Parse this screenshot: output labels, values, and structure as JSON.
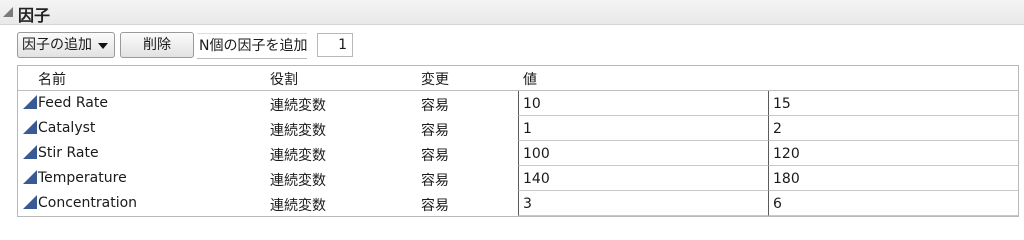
{
  "section": {
    "title": "因子"
  },
  "toolbar": {
    "add_factor_label": "因子の追加",
    "delete_label": "削除",
    "n_factors_label": "N個の因子を追加",
    "n_factors_value": "1"
  },
  "table": {
    "headers": {
      "name": "名前",
      "role": "役割",
      "change": "変更",
      "values": "値"
    },
    "rows": [
      {
        "name": "Feed Rate",
        "role": "連続変数",
        "change": "容易",
        "low": "10",
        "high": "15"
      },
      {
        "name": "Catalyst",
        "role": "連続変数",
        "change": "容易",
        "low": "1",
        "high": "2"
      },
      {
        "name": "Stir Rate",
        "role": "連続変数",
        "change": "容易",
        "low": "100",
        "high": "120"
      },
      {
        "name": "Temperature",
        "role": "連続変数",
        "change": "容易",
        "low": "140",
        "high": "180"
      },
      {
        "name": "Concentration",
        "role": "連続変数",
        "change": "容易",
        "low": "3",
        "high": "6"
      }
    ]
  },
  "colors": {
    "factor_icon": "#3a5a96"
  },
  "icons": {
    "disclosure": "disclosure-triangle-icon",
    "factor": "continuous-factor-icon",
    "dropdown": "chevron-down-icon"
  }
}
